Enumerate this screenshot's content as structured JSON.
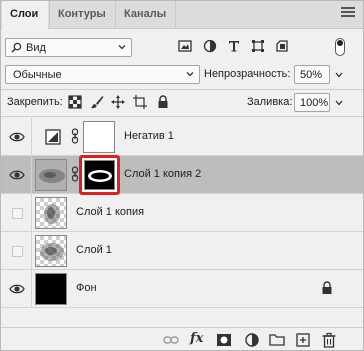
{
  "tabs": [
    {
      "label": "Слои",
      "active": true
    },
    {
      "label": "Контуры",
      "active": false
    },
    {
      "label": "Каналы",
      "active": false
    }
  ],
  "filter": {
    "kind_value": "Вид",
    "icons": [
      "pixel-filter-icon",
      "adjustment-filter-icon",
      "type-filter-icon",
      "shape-filter-icon",
      "smart-object-filter-icon"
    ]
  },
  "blend": {
    "mode_value": "Обычные",
    "opacity_label": "Непрозрачность:",
    "opacity_value": "50%",
    "fill_label": "Заливка:",
    "fill_value": "100%"
  },
  "lock": {
    "label": "Закрепить:",
    "icons": [
      "lock-transparent-icon",
      "lock-image-icon",
      "lock-position-icon",
      "lock-artboard-icon",
      "lock-all-icon"
    ]
  },
  "layers": [
    {
      "name": "Негатив 1",
      "visible": true,
      "selected": false,
      "type": "adjustment"
    },
    {
      "name": "Слой 1 копия 2",
      "visible": true,
      "selected": true,
      "type": "masked"
    },
    {
      "name": "Слой 1 копия",
      "visible": false,
      "selected": false,
      "type": "pixel"
    },
    {
      "name": "Слой 1",
      "visible": false,
      "selected": false,
      "type": "pixel"
    },
    {
      "name": "Фон",
      "visible": true,
      "selected": false,
      "type": "background",
      "locked": true
    }
  ],
  "bottom_icons": [
    "link-layers-icon",
    "fx-icon",
    "add-mask-icon",
    "new-adjustment-icon",
    "new-group-icon",
    "new-layer-icon",
    "delete-layer-icon"
  ],
  "bottom_fx_label": "fx",
  "colors": {
    "panel_bg": "#f0f0f0",
    "selected_row": "#bdbdbd",
    "mask_highlight": "#e02020"
  }
}
